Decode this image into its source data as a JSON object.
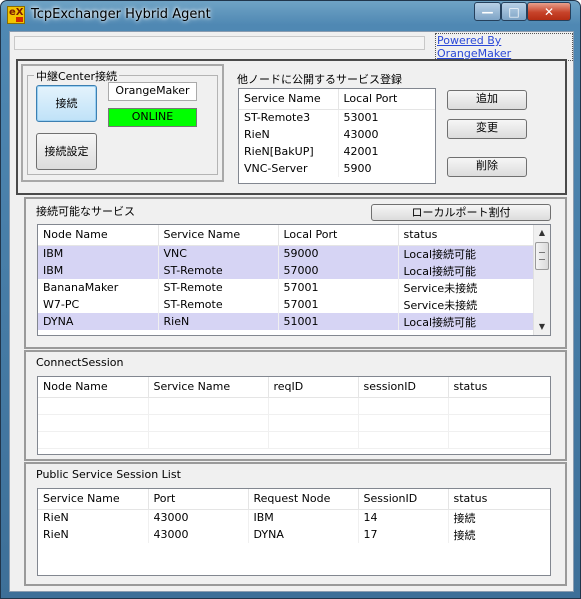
{
  "window": {
    "title": "TcpExchanger Hybrid Agent",
    "icon_text": "eX",
    "powered_by": "Powered By OrangeMaker"
  },
  "relay_center": {
    "legend": "中継Center接続",
    "connect_label": "接続",
    "server_name": "OrangeMaker",
    "status": "ONLINE",
    "settings_label": "接続設定"
  },
  "publish_services": {
    "title": "他ノードに公開するサービス登録",
    "columns": [
      "Service Name",
      "Local Port"
    ],
    "rows": [
      [
        "ST-Remote3",
        "53001"
      ],
      [
        "RieN",
        "43000"
      ],
      [
        "RieN[BakUP]",
        "42001"
      ],
      [
        "VNC-Server",
        "5900"
      ]
    ],
    "add_label": "追加",
    "edit_label": "変更",
    "delete_label": "削除"
  },
  "available_services": {
    "title": "接続可能なサービス",
    "assign_port_label": "ローカルポート割付",
    "columns": [
      "Node Name",
      "Service Name",
      "Local Port",
      "status"
    ],
    "rows": [
      [
        "IBM",
        "VNC",
        "59000",
        "Local接続可能"
      ],
      [
        "IBM",
        "ST-Remote",
        "57000",
        "Local接続可能"
      ],
      [
        "BananaMaker",
        "ST-Remote",
        "57001",
        "Service未接続"
      ],
      [
        "W7-PC",
        "ST-Remote",
        "57001",
        "Service未接続"
      ],
      [
        "DYNA",
        "RieN",
        "51001",
        "Local接続可能"
      ]
    ]
  },
  "connect_session": {
    "title": "ConnectSession",
    "columns": [
      "Node Name",
      "Service Name",
      "reqID",
      "sessionID",
      "status"
    ]
  },
  "public_sessions": {
    "title": "Public Service Session List",
    "columns": [
      "Service Name",
      "Port",
      "Request Node",
      "SessionID",
      "status"
    ],
    "rows": [
      [
        "RieN",
        "43000",
        "IBM",
        "14",
        "接続"
      ],
      [
        "RieN",
        "43000",
        "DYNA",
        "17",
        "接続"
      ]
    ]
  },
  "colors": {
    "highlight_row": "#d6d4f4",
    "online": "#00ff00",
    "link": "#2a48d8"
  }
}
